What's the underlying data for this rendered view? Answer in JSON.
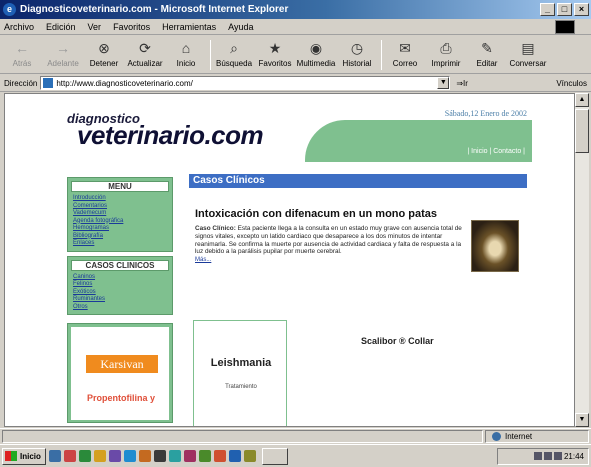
{
  "window": {
    "title": "Diagnosticoveterinario.com - Microsoft Internet Explorer",
    "min_label": "_",
    "max_label": "□",
    "close_label": "×"
  },
  "menubar": {
    "items": [
      "Archivo",
      "Edición",
      "Ver",
      "Favoritos",
      "Herramientas",
      "Ayuda"
    ]
  },
  "toolbar": {
    "buttons": [
      {
        "label": "Atrás",
        "icon": "back-arrow-icon",
        "enabled": false
      },
      {
        "label": "Adelante",
        "icon": "forward-arrow-icon",
        "enabled": false
      },
      {
        "label": "Detener",
        "icon": "stop-icon",
        "enabled": true
      },
      {
        "label": "Actualizar",
        "icon": "refresh-icon",
        "enabled": true
      },
      {
        "label": "Inicio",
        "icon": "home-icon",
        "enabled": true
      },
      {
        "label": "Búsqueda",
        "icon": "search-icon",
        "enabled": true
      },
      {
        "label": "Favoritos",
        "icon": "favorites-icon",
        "enabled": true
      },
      {
        "label": "Multimedia",
        "icon": "media-icon",
        "enabled": true
      },
      {
        "label": "Historial",
        "icon": "history-icon",
        "enabled": true
      },
      {
        "label": "Correo",
        "icon": "mail-icon",
        "enabled": true
      },
      {
        "label": "Imprimir",
        "icon": "print-icon",
        "enabled": true
      },
      {
        "label": "Editar",
        "icon": "edit-icon",
        "enabled": true
      },
      {
        "label": "Conversar",
        "icon": "discuss-icon",
        "enabled": true
      }
    ]
  },
  "addressbar": {
    "label": "Dirección",
    "url": "http://www.diagnosticoveterinario.com/",
    "go_label": "Ir",
    "links_label": "Vínculos"
  },
  "page": {
    "logo_top": "diagnostico",
    "logo_main": "veterinario.com",
    "date": "Sábado,12 Enero de 2002",
    "nav_links": "| Inicio | Contacto |",
    "menu": {
      "title": "MENU",
      "items": [
        "Introducción",
        "Comentarios",
        "Vademecum",
        "Agenda fotográfica",
        "Hemogramas",
        "Bibliografía",
        "Enlaces"
      ]
    },
    "casos": {
      "title": "CASOS CLINICOS",
      "items": [
        "Caninos",
        "Felinos",
        "Exóticos",
        "Ruminantes",
        "Otros"
      ]
    },
    "ad": {
      "brand": "Karsivan",
      "text": "Propentofilina y"
    },
    "section_title": "Casos Clínicos",
    "article": {
      "title": "Intoxicación con difenacum en un mono patas",
      "lead": "Caso Clínico:",
      "body": "Esta paciente llega a la consulta en un estado muy grave con ausencia total de signos vitales, excepto un latido cardiaco que desaparece a los dos minutos de intentar reanimarla. Se confirma la muerte por ausencia de actividad cardiaca y falta de respuesta a la luz debido a la parálisis pupilar por muerte cerebral.",
      "more": "Más..."
    },
    "leish": {
      "title": "Leishmania",
      "subtitle": "Tratamiento"
    },
    "scalibor": "Scalibor ® Collar"
  },
  "statusbar": {
    "zone": "Internet"
  },
  "taskbar": {
    "start_label": "Inicio",
    "clock": "21:44",
    "icon_colors": [
      "#3a6ea5",
      "#c44",
      "#2a8a3a",
      "#d4a020",
      "#6a4aa8",
      "#1e8cd0",
      "#c46a20",
      "#3a3a3a",
      "#2aa0a0",
      "#a03060",
      "#4a8a2a",
      "#d05030",
      "#2060b0",
      "#8a8a2a",
      "#b03030",
      "#3070c0",
      "#c0a030",
      "#507050"
    ]
  }
}
